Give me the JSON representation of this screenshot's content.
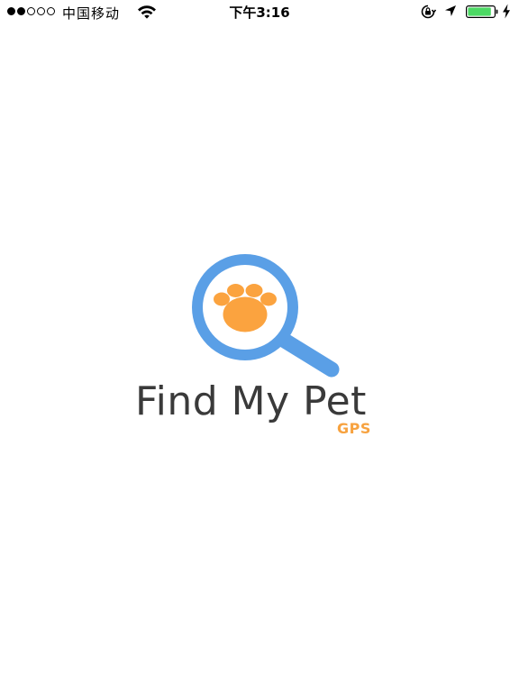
{
  "status_bar": {
    "carrier": "中国移动",
    "time": "下午3:16",
    "signal_filled": 2,
    "signal_total": 5,
    "battery_level": 0.9
  },
  "splash": {
    "title": "Find My Pet",
    "subtitle": "GPS",
    "logo_icon": "magnifier-paw-icon"
  },
  "colors": {
    "background": "#ffffff",
    "magnifier_blue": "#5a9fe6",
    "paw_orange": "#fba33f",
    "title_text": "#3a3a3a",
    "subtitle_orange": "#f7a23f",
    "battery_green": "#4cd964"
  }
}
